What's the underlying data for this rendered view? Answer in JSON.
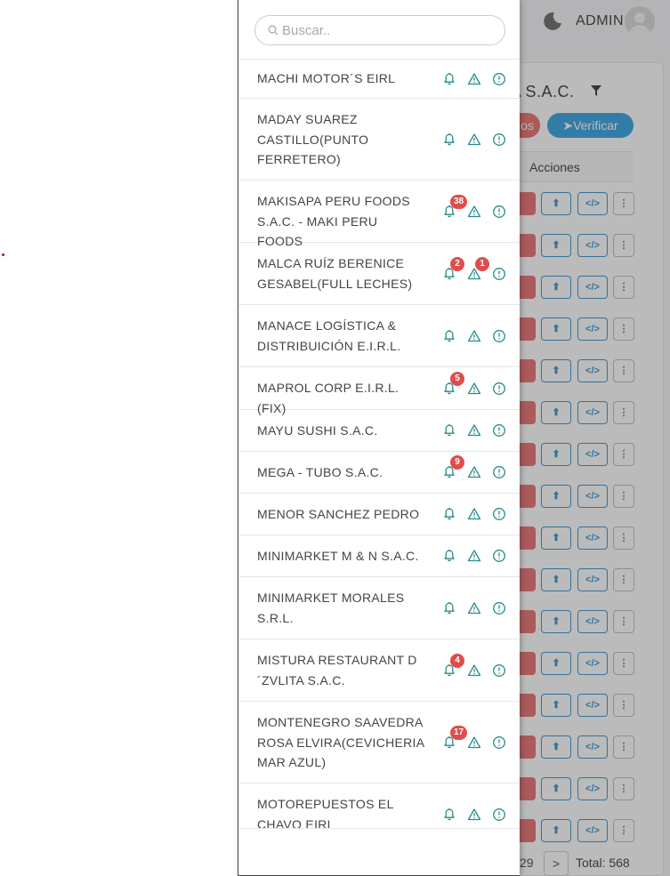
{
  "header": {
    "user_label": "ADMIN"
  },
  "background": {
    "company_title": "HA S.A.C.",
    "red_button_label": "os",
    "verify_button_label": "Verificar",
    "table_header": "Acciones",
    "pager_prev_text": "29",
    "pager_next_label": ">",
    "total_text": "Total: 568",
    "colors": {
      "red": "#e86a6a",
      "blue": "#2f9fe0"
    }
  },
  "search": {
    "placeholder": "Buscar..",
    "value": ""
  },
  "list_icons": [
    "bell-icon",
    "warning-triangle-icon",
    "info-circle-icon"
  ],
  "icon_color": "#2a8a8a",
  "badge_color": "#e04c4c",
  "companies": [
    {
      "name": "MACHI MOTOR´S EIRL",
      "bell": "",
      "warn": ""
    },
    {
      "name": "MADAY SUAREZ CASTILLO(PUNTO FERRETERO)",
      "bell": "",
      "warn": ""
    },
    {
      "name": "MAKISAPA PERU FOODS S.A.C. - MAKI PERU FOODS",
      "bell": "38",
      "warn": ""
    },
    {
      "name": "MALCA RUÍZ BERENICE GESABEL(FULL LECHES)",
      "bell": "2",
      "warn": "1"
    },
    {
      "name": "MANACE LOGÍSTICA & DISTRIBUICIÓN E.I.R.L.",
      "bell": "",
      "warn": ""
    },
    {
      "name": "MAPROL CORP E.I.R.L. (FIX)",
      "bell": "5",
      "warn": ""
    },
    {
      "name": "MAYU SUSHI S.A.C.",
      "bell": "",
      "warn": ""
    },
    {
      "name": "MEGA - TUBO S.A.C.",
      "bell": "9",
      "warn": ""
    },
    {
      "name": "MENOR SANCHEZ PEDRO",
      "bell": "",
      "warn": ""
    },
    {
      "name": "MINIMARKET M & N S.A.C.",
      "bell": "",
      "warn": ""
    },
    {
      "name": "MINIMARKET MORALES S.R.L.",
      "bell": "",
      "warn": ""
    },
    {
      "name": "MISTURA RESTAURANT D ´ZVLITA S.A.C.",
      "bell": "4",
      "warn": ""
    },
    {
      "name": "MONTENEGRO SAAVEDRA ROSA ELVIRA(CEVICHERIA MAR AZUL)",
      "bell": "17",
      "warn": ""
    },
    {
      "name": "MOTOREPUESTOS EL CHAVO EIRL",
      "bell": "",
      "warn": ""
    }
  ]
}
